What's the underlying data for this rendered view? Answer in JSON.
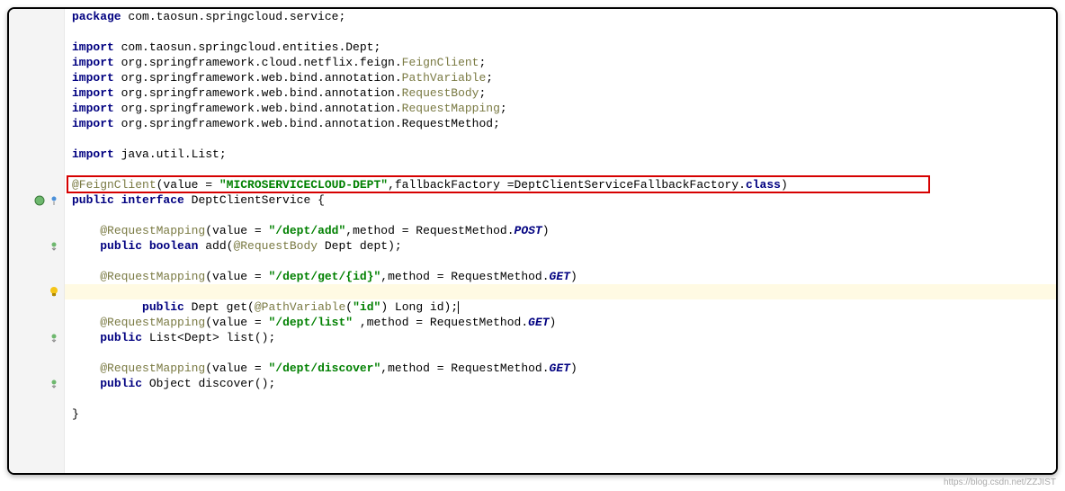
{
  "watermark": "https://blog.csdn.net/ZZJIST",
  "code": {
    "package_kw": "package",
    "package_name": " com.taosun.springcloud.service;",
    "import_kw": "import",
    "imp1": " com.taosun.springcloud.entities.Dept;",
    "imp2a": " org.springframework.cloud.netflix.feign.",
    "imp2b": "FeignClient",
    "imp3a": " org.springframework.web.bind.annotation.",
    "imp3b": "PathVariable",
    "imp4a": " org.springframework.web.bind.annotation.",
    "imp4b": "RequestBody",
    "imp5a": " org.springframework.web.bind.annotation.",
    "imp5b": "RequestMapping",
    "imp6": " org.springframework.web.bind.annotation.RequestMethod;",
    "imp7": " java.util.List;",
    "feign_ann": "@FeignClient",
    "feign_open": "(value = ",
    "feign_str": "\"MICROSERVICECLOUD-DEPT\"",
    "feign_mid": ",fallbackFactory =DeptClientServiceFallbackFactory.",
    "feign_class": "class",
    "feign_close": ")",
    "public_kw": "public",
    "interface_kw": "interface",
    "class_name": " DeptClientService {",
    "rm_ann": "@RequestMapping",
    "rm1_open": "(value = ",
    "rm1_str": "\"/dept/add\"",
    "rm1_mid": ",method = RequestMethod.",
    "rm1_meth": "POST",
    "rm1_close": ")",
    "m1_kw": "public boolean",
    "m1_name": " add(",
    "m1_ann": "@RequestBody",
    "m1_rest": " Dept dept);",
    "rm2_open": "(value = ",
    "rm2_str": "\"/dept/get/{id}\"",
    "rm2_mid": ",method = RequestMethod.",
    "rm2_meth": "GET",
    "rm2_close": ")",
    "m2_kw": "public",
    "m2_mid": " Dept get(",
    "m2_ann": "@PathVariable",
    "m2_open": "(",
    "m2_str": "\"id\"",
    "m2_close": ") Long id);",
    "rm3_open": "(value = ",
    "rm3_str": "\"/dept/list\"",
    "rm3_mid": " ,method = RequestMethod.",
    "rm3_meth": "GET",
    "rm3_close": ")",
    "m3_kw": "public",
    "m3_rest": " List<Dept> list();",
    "rm4_open": "(value = ",
    "rm4_str": "\"/dept/discover\"",
    "rm4_mid": ",method = RequestMethod.",
    "rm4_meth": "GET",
    "rm4_close": ")",
    "m4_kw": "public",
    "m4_rest": " Object discover();",
    "close_brace": "}"
  }
}
